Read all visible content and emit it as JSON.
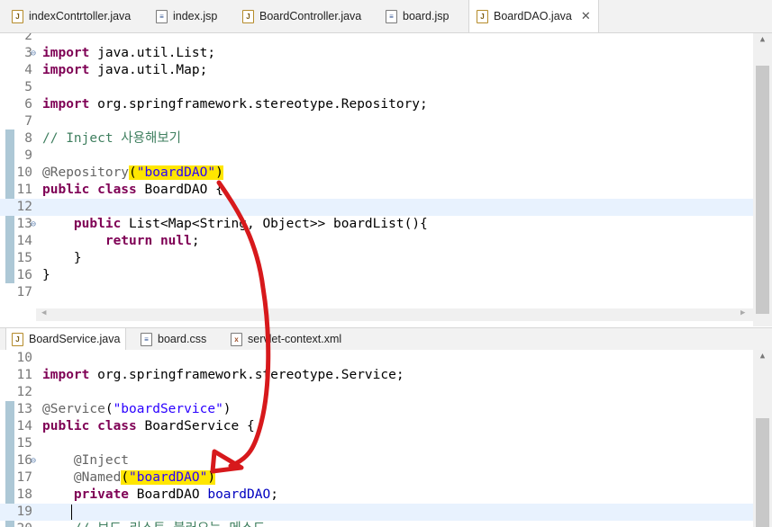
{
  "top_tabs": [
    {
      "label": "indexContrtoller.java",
      "type": "java"
    },
    {
      "label": "index.jsp",
      "type": "jsp"
    },
    {
      "label": "BoardController.java",
      "type": "java"
    },
    {
      "label": "board.jsp",
      "type": "jsp"
    },
    {
      "label": "BoardDAO.java",
      "type": "java",
      "active": true
    }
  ],
  "top_close": "✕",
  "top_editor": {
    "lines": [
      {
        "n": "2",
        "code": ""
      },
      {
        "n": "3",
        "code": "import java.util.List;"
      },
      {
        "n": "4",
        "code": "import java.util.Map;"
      },
      {
        "n": "5",
        "code": ""
      },
      {
        "n": "6",
        "code": "import org.springframework.stereotype.Repository;"
      },
      {
        "n": "7",
        "code": ""
      },
      {
        "n": "8",
        "code": "// Inject 사용해보기"
      },
      {
        "n": "9",
        "code": ""
      },
      {
        "n": "10",
        "code": "@Repository(\"boardDAO\")"
      },
      {
        "n": "11",
        "code": "public class BoardDAO {"
      },
      {
        "n": "12",
        "code": ""
      },
      {
        "n": "13",
        "code": "    public List<Map<String, Object>> boardList(){"
      },
      {
        "n": "14",
        "code": "        return null;"
      },
      {
        "n": "15",
        "code": "    }"
      },
      {
        "n": "16",
        "code": "}"
      },
      {
        "n": "17",
        "code": ""
      }
    ]
  },
  "bottom_tabs": [
    {
      "label": "BoardService.java",
      "type": "java",
      "active": true
    },
    {
      "label": "board.css",
      "type": "css"
    },
    {
      "label": "servlet-context.xml",
      "type": "xml"
    }
  ],
  "bottom_editor": {
    "lines": [
      {
        "n": "10",
        "code": ""
      },
      {
        "n": "11",
        "code": "import org.springframework.stereotype.Service;"
      },
      {
        "n": "12",
        "code": ""
      },
      {
        "n": "13",
        "code": "@Service(\"boardService\")"
      },
      {
        "n": "14",
        "code": "public class BoardService {"
      },
      {
        "n": "15",
        "code": ""
      },
      {
        "n": "16",
        "code": "    @Inject"
      },
      {
        "n": "17",
        "code": "    @Named(\"boardDAO\")"
      },
      {
        "n": "18",
        "code": "    private BoardDAO boardDAO;"
      },
      {
        "n": "19",
        "code": ""
      },
      {
        "n": "20",
        "code": "    // 보드 리스트 불러오는 메소드"
      }
    ]
  },
  "colors": {
    "keyword": "#7f0055",
    "string": "#2a00ff",
    "annotation": "#646464",
    "comment": "#3f7f5f",
    "highlight": "#ffe600",
    "arrow": "#d7191c"
  }
}
